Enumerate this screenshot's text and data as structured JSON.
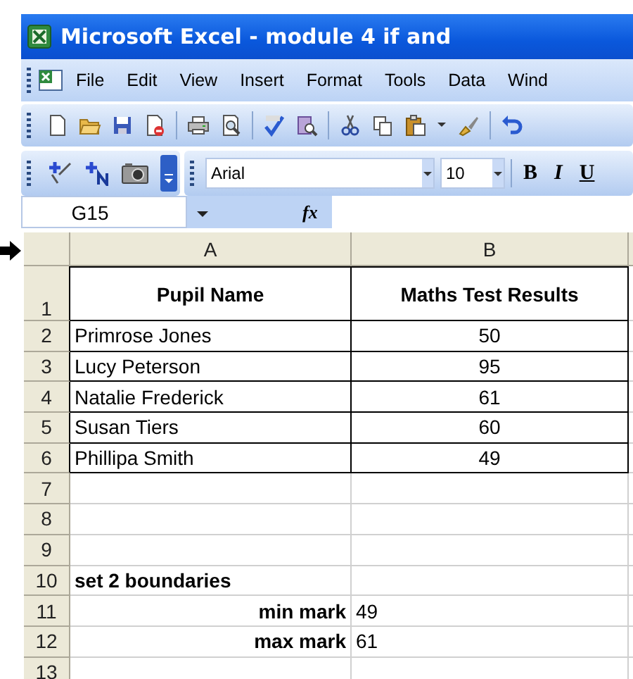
{
  "window": {
    "title": "Microsoft Excel - module 4 if and"
  },
  "menu": [
    "File",
    "Edit",
    "View",
    "Insert",
    "Format",
    "Tools",
    "Data",
    "Wind"
  ],
  "format_toolbar": {
    "font": "Arial",
    "size": "10",
    "buttons": [
      "B",
      "I",
      "U"
    ]
  },
  "formula_bar": {
    "name_box": "G15",
    "fx": "fx"
  },
  "sheet": {
    "columns": [
      "A",
      "B"
    ],
    "rows": [
      {
        "label": "1",
        "bordered": true,
        "cells": [
          {
            "text": "Pupil Name",
            "kind": "heading"
          },
          {
            "text": "Maths Test Results",
            "kind": "heading"
          }
        ]
      },
      {
        "label": "2",
        "bordered": true,
        "cells": [
          {
            "text": "Primrose Jones",
            "kind": "text"
          },
          {
            "text": "50",
            "kind": "centered"
          }
        ]
      },
      {
        "label": "3",
        "bordered": true,
        "cells": [
          {
            "text": "Lucy Peterson",
            "kind": "text"
          },
          {
            "text": "95",
            "kind": "centered"
          }
        ]
      },
      {
        "label": "4",
        "bordered": true,
        "cells": [
          {
            "text": "Natalie Frederick",
            "kind": "text"
          },
          {
            "text": "61",
            "kind": "centered"
          }
        ]
      },
      {
        "label": "5",
        "bordered": true,
        "cells": [
          {
            "text": "Susan Tiers",
            "kind": "text"
          },
          {
            "text": "60",
            "kind": "centered"
          }
        ]
      },
      {
        "label": "6",
        "bordered": true,
        "cells": [
          {
            "text": "Phillipa Smith",
            "kind": "text"
          },
          {
            "text": "49",
            "kind": "centered"
          }
        ]
      },
      {
        "label": "7",
        "bordered": false,
        "cells": []
      },
      {
        "label": "8",
        "bordered": false,
        "cells": []
      },
      {
        "label": "9",
        "bordered": false,
        "cells": []
      },
      {
        "label": "10",
        "bordered": false,
        "cells": [
          {
            "text": "set 2 boundaries",
            "kind": "title"
          }
        ]
      },
      {
        "label": "11",
        "bordered": false,
        "cells": [
          {
            "text": "min mark",
            "kind": "label"
          },
          {
            "text": "49",
            "kind": "text"
          }
        ]
      },
      {
        "label": "12",
        "bordered": false,
        "cells": [
          {
            "text": "max mark",
            "kind": "label"
          },
          {
            "text": "61",
            "kind": "text"
          }
        ]
      },
      {
        "label": "13",
        "bordered": false,
        "cells": []
      }
    ]
  }
}
